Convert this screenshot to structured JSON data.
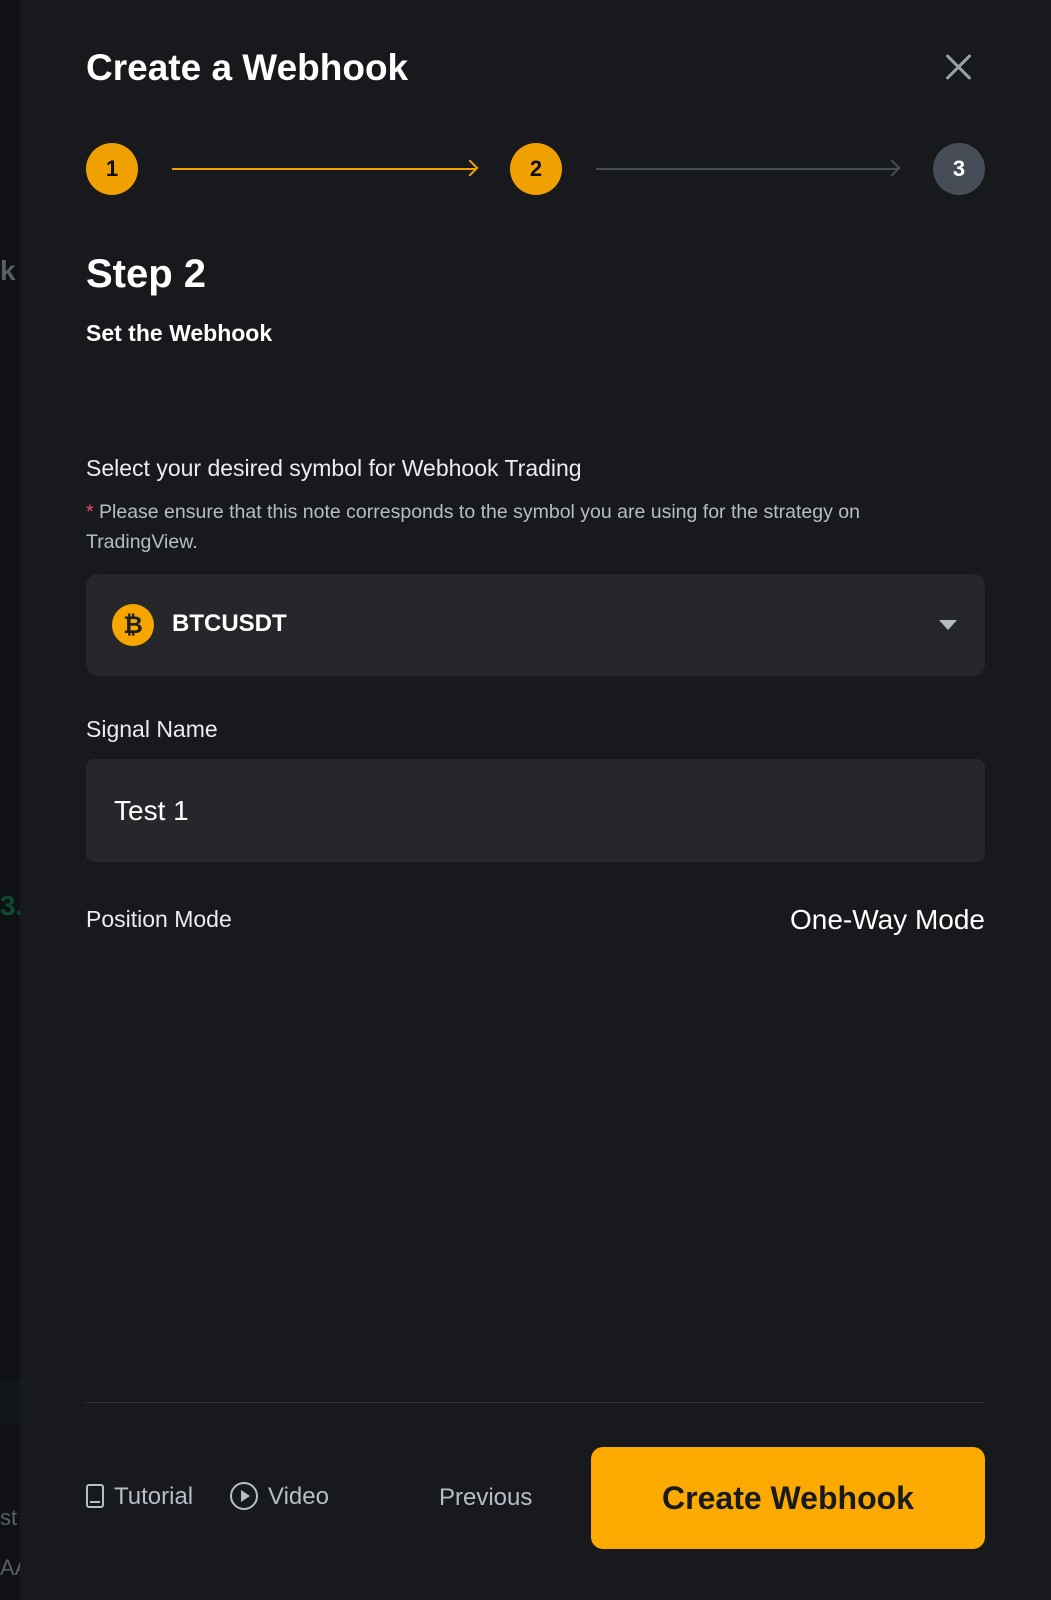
{
  "colors": {
    "accent": "#f0a000",
    "panel_bg": "#18191d",
    "field_bg": "#25272b",
    "required": "#f6465d",
    "inactive_step": "#474d57"
  },
  "header": {
    "title": "Create a Webhook",
    "close_icon": "close-icon"
  },
  "stepper": {
    "steps": [
      {
        "label": "1",
        "state": "completed"
      },
      {
        "label": "2",
        "state": "active"
      },
      {
        "label": "3",
        "state": "inactive"
      }
    ]
  },
  "step": {
    "title": "Step 2",
    "subtitle": "Set the Webhook"
  },
  "symbol": {
    "label": "Select your desired symbol for Webhook Trading",
    "required_mark": "*",
    "note": " Please ensure that this note corresponds to the symbol you are using for the strategy on TradingView.",
    "selected": "BTCUSDT",
    "coin_icon_glyph": "₿",
    "icon": "bitcoin-icon"
  },
  "signal": {
    "label": "Signal Name",
    "value": "Test 1"
  },
  "position": {
    "label": "Position Mode",
    "value": "One-Way Mode"
  },
  "footer": {
    "tutorial": "Tutorial",
    "video": "Video",
    "previous": "Previous",
    "create": "Create Webhook"
  },
  "background_fragments": {
    "frag_k": "k",
    "frag_3": "3.",
    "frag_st": "st",
    "frag_aa": "AA"
  }
}
